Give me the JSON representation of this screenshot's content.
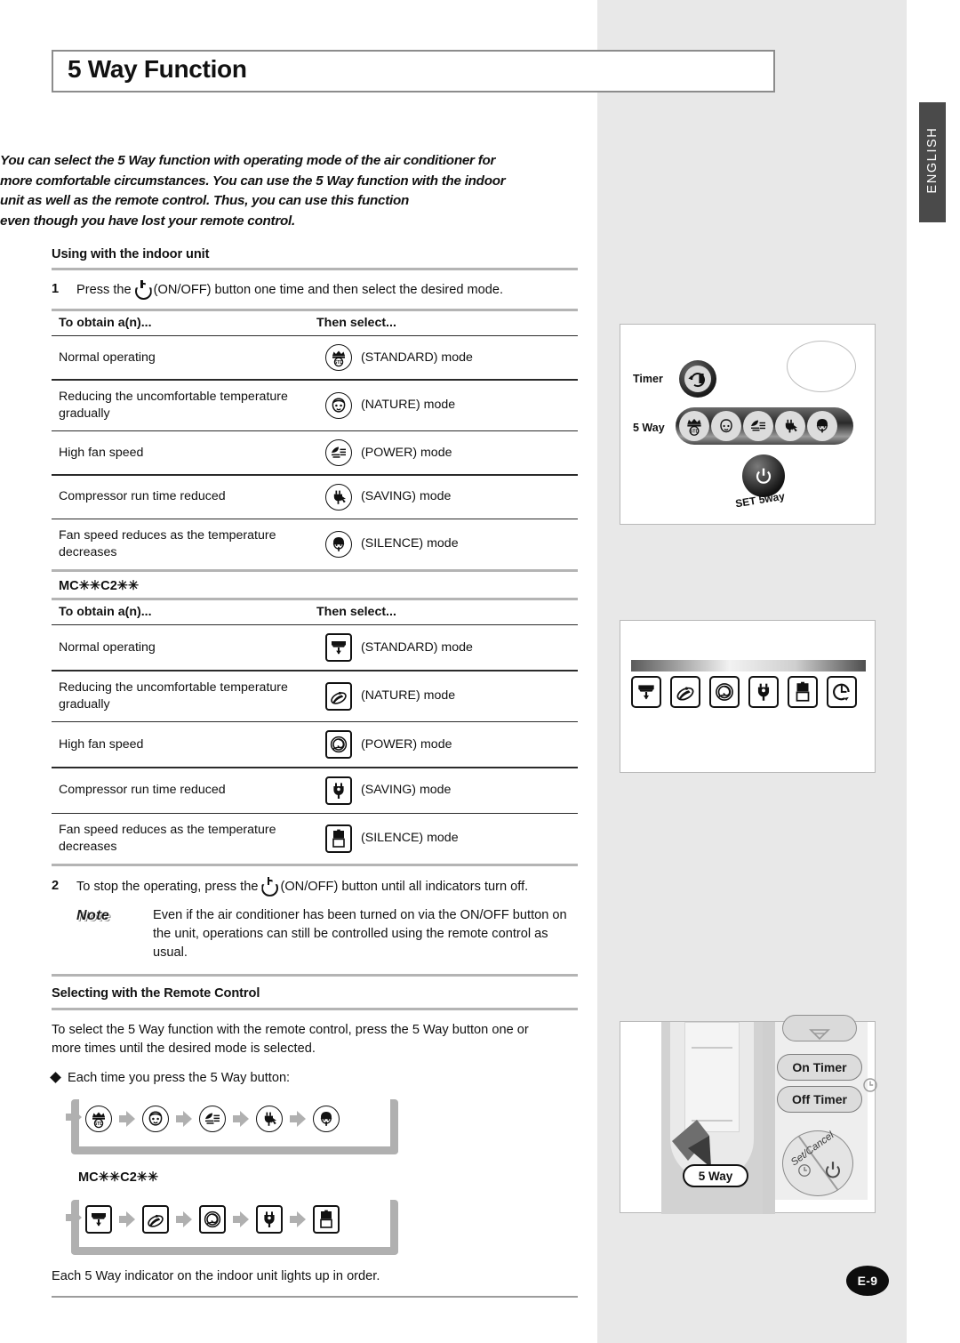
{
  "page": {
    "title": "5 Way Function",
    "language_tab": "ENGLISH",
    "page_number": "E-9"
  },
  "intro": {
    "lines": [
      "You can select the 5 Way function with operating mode of the air conditioner for",
      "more comfortable circumstances. You can use the 5 Way function with the indoor",
      "unit as well as the remote control. Thus, you can use this function",
      "even though you have lost your remote control."
    ]
  },
  "section_indoor": {
    "heading": "Using with the indoor unit",
    "step1": {
      "number": "1",
      "text_before_icon": "Press the",
      "text_after_icon": "(ON/OFF) button one time and then select the desired mode."
    },
    "table": {
      "col1_header": "To obtain a(n)...",
      "col2_header": "Then select...",
      "rows": [
        {
          "obtain": "Normal operating",
          "icon": "standard-crown-icon",
          "select": "(STANDARD) mode"
        },
        {
          "obtain": "Reducing the uncomfortable temperature gradually",
          "icon": "nature-baby-icon",
          "select": "(NATURE) mode"
        },
        {
          "obtain": "High fan speed",
          "icon": "power-wind-icon",
          "select": "(POWER) mode"
        },
        {
          "obtain": "Compressor run time reduced",
          "icon": "saving-plug-icon",
          "select": "(SAVING) mode"
        },
        {
          "obtain": "Fan speed reduces as the temperature decreases",
          "icon": "silence-shh-icon",
          "select": "(SILENCE) mode"
        }
      ]
    },
    "model_label": "MC✳✳C2✳✳",
    "table_mc": {
      "col1_header": "To obtain a(n)...",
      "col2_header": "Then select...",
      "rows": [
        {
          "obtain": "Normal operating",
          "icon": "standard-square-icon",
          "select": "(STANDARD) mode"
        },
        {
          "obtain": "Reducing the uncomfortable temperature gradually",
          "icon": "nature-square-icon",
          "select": "(NATURE) mode"
        },
        {
          "obtain": "High fan speed",
          "icon": "power-square-icon",
          "select": "(POWER) mode"
        },
        {
          "obtain": "Compressor run time reduced",
          "icon": "saving-square-icon",
          "select": "(SAVING) mode"
        },
        {
          "obtain": "Fan speed reduces as the temperature decreases",
          "icon": "silence-square-icon",
          "select": "(SILENCE) mode"
        }
      ]
    },
    "step2": {
      "number": "2",
      "text_before_icon": "To stop the operating, press the",
      "text_after_icon": "(ON/OFF) button until all indicators turn off."
    },
    "note": {
      "tag": "Note",
      "text": "Even if the air conditioner has been turned on via the ON/OFF button on the unit, operations can still be controlled using the remote control as usual."
    }
  },
  "section_remote": {
    "heading": "Selecting with the Remote Control",
    "intro": "To select the 5 Way function with the remote control, press the 5 Way button one or more times until the desired mode is selected.",
    "bullet": "Each time you press the 5 Way button:",
    "flow_round": [
      "standard-crown-icon",
      "nature-baby-icon",
      "power-wind-icon",
      "saving-plug-icon",
      "silence-shh-icon"
    ],
    "model_label": "MC✳✳C2✳✳",
    "flow_square": [
      "standard-square-icon",
      "nature-square-icon",
      "power-square-icon",
      "saving-square-icon",
      "silence-square-icon"
    ],
    "closing": "Each 5 Way indicator on the indoor unit lights up in order."
  },
  "illustrations": {
    "panel_indoor_unit": {
      "timer_label": "Timer",
      "fiveway_label": "5 Way",
      "set_label": "SET 5way"
    },
    "panel_display_icons": {
      "icons": [
        "standard-square-icon",
        "nature-square-icon",
        "power-square-icon",
        "saving-square-icon",
        "silence-square-icon",
        "timer-clock-icon"
      ]
    },
    "panel_remote": {
      "on_timer": "On Timer",
      "off_timer": "Off Timer",
      "set_cancel": "Set/Cancel",
      "fiveway_button": "5 Way"
    }
  },
  "colors": {
    "band_gray": "#e8e8e8",
    "tab_dark": "#4a4a4a",
    "rule_gray": "#b4b4b4",
    "arrow_gray": "#b0b0b0"
  }
}
